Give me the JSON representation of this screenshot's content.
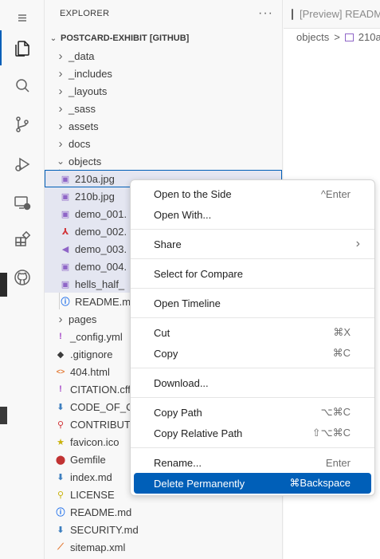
{
  "sidebar": {
    "title": "EXPLORER",
    "more": "···",
    "section": "POSTCARD-EXHIBIT [GITHUB]",
    "items": [
      {
        "label": "_data",
        "kind": "folder",
        "expanded": false
      },
      {
        "label": "_includes",
        "kind": "folder",
        "expanded": false
      },
      {
        "label": "_layouts",
        "kind": "folder",
        "expanded": false
      },
      {
        "label": "_sass",
        "kind": "folder",
        "expanded": false
      },
      {
        "label": "assets",
        "kind": "folder",
        "expanded": false
      },
      {
        "label": "docs",
        "kind": "folder",
        "expanded": false
      },
      {
        "label": "objects",
        "kind": "folder",
        "expanded": true
      },
      {
        "label": "210a.jpg",
        "kind": "image",
        "selected": true,
        "focused": true
      },
      {
        "label": "210b.jpg",
        "kind": "image",
        "selected": true
      },
      {
        "label": "demo_001.",
        "kind": "image",
        "selected": true
      },
      {
        "label": "demo_002.",
        "kind": "pdf",
        "selected": true
      },
      {
        "label": "demo_003.",
        "kind": "audio",
        "selected": true
      },
      {
        "label": "demo_004.",
        "kind": "image",
        "selected": true
      },
      {
        "label": "hells_half_",
        "kind": "image",
        "selected": true
      },
      {
        "label": "README.m",
        "kind": "info",
        "selected": false
      },
      {
        "label": "pages",
        "kind": "folder",
        "expanded": false
      },
      {
        "label": "_config.yml",
        "kind": "yaml"
      },
      {
        "label": ".gitignore",
        "kind": "git"
      },
      {
        "label": "404.html",
        "kind": "html"
      },
      {
        "label": "CITATION.cff",
        "kind": "yaml"
      },
      {
        "label": "CODE_OF_C",
        "kind": "md"
      },
      {
        "label": "CONTRIBUT",
        "kind": "contrib"
      },
      {
        "label": "favicon.ico",
        "kind": "star"
      },
      {
        "label": "Gemfile",
        "kind": "gem"
      },
      {
        "label": "index.md",
        "kind": "md"
      },
      {
        "label": "LICENSE",
        "kind": "license"
      },
      {
        "label": "README.md",
        "kind": "info"
      },
      {
        "label": "SECURITY.md",
        "kind": "md"
      },
      {
        "label": "sitemap.xml",
        "kind": "rss"
      }
    ]
  },
  "editor": {
    "tab_label": "[Preview] README.md",
    "breadcrumb_folder": "objects",
    "breadcrumb_sep": ">",
    "breadcrumb_file": "210a"
  },
  "context_menu": {
    "groups": [
      [
        {
          "label": "Open to the Side",
          "key": "^Enter"
        },
        {
          "label": "Open With...",
          "key": ""
        }
      ],
      [
        {
          "label": "Share",
          "key": "",
          "submenu": true
        }
      ],
      [
        {
          "label": "Select for Compare",
          "key": ""
        }
      ],
      [
        {
          "label": "Open Timeline",
          "key": ""
        }
      ],
      [
        {
          "label": "Cut",
          "key": "⌘X"
        },
        {
          "label": "Copy",
          "key": "⌘C"
        }
      ],
      [
        {
          "label": "Download...",
          "key": ""
        }
      ],
      [
        {
          "label": "Copy Path",
          "key": "⌥⌘C"
        },
        {
          "label": "Copy Relative Path",
          "key": "⇧⌥⌘C"
        }
      ],
      [
        {
          "label": "Rename...",
          "key": "Enter"
        },
        {
          "label": "Delete Permanently",
          "key": "⌘Backspace",
          "highlighted": true
        }
      ]
    ]
  },
  "colors": {
    "accent": "#005fb8",
    "selection": "#e4e6f1",
    "folder_icon": "#8a8a8a",
    "image_icon": "#8f65c7",
    "pdf_icon": "#d13438",
    "info_icon": "#1f6feb",
    "md_icon": "#3c7ebf",
    "yaml_icon": "#a74ac9",
    "html_icon": "#e37933",
    "star_icon": "#c9b20b",
    "gem_icon": "#c13333",
    "license_icon": "#c9b20b",
    "rss_icon": "#e37933"
  }
}
